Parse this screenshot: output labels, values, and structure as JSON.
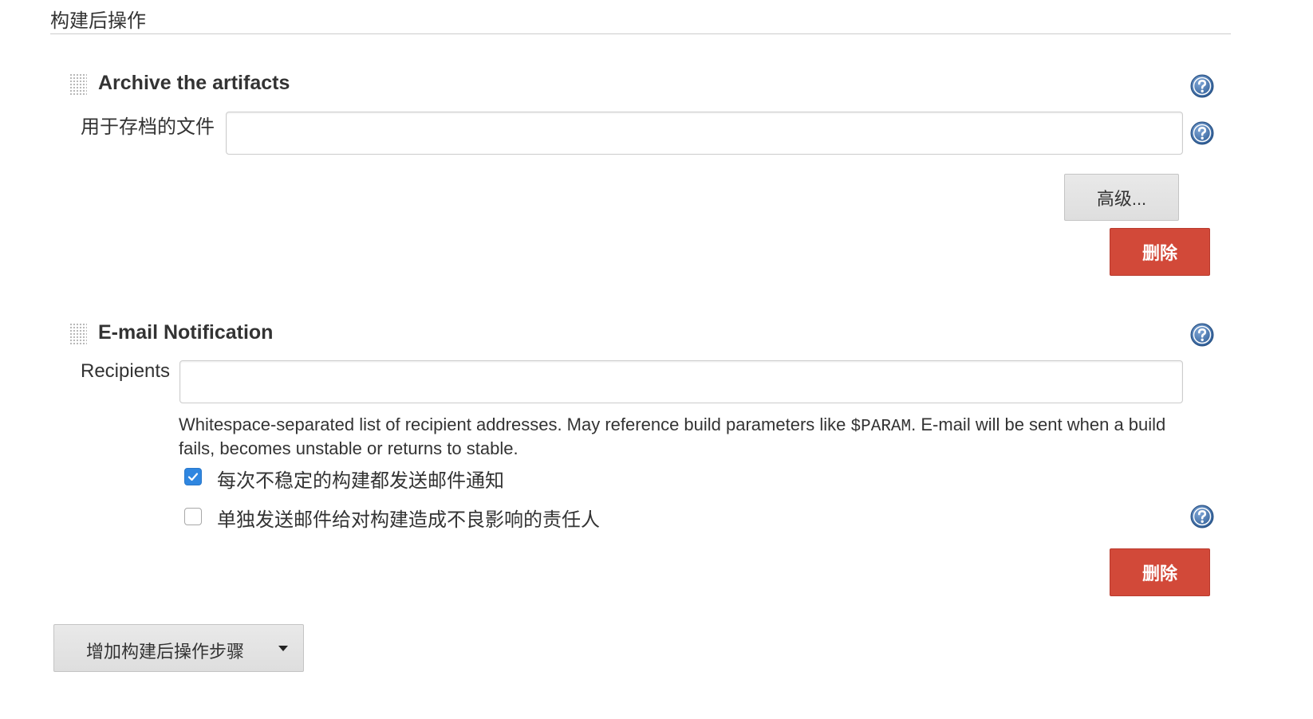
{
  "section": {
    "title": "构建后操作"
  },
  "archive": {
    "title": "Archive the artifacts",
    "files_label": "用于存档的文件",
    "files_value": "",
    "advanced_label": "高级...",
    "delete_label": "删除"
  },
  "email": {
    "title": "E-mail Notification",
    "recipients_label": "Recipients",
    "recipients_value": "",
    "description_before": "Whitespace-separated list of recipient addresses. May reference build parameters like ",
    "description_code": "$PARAM",
    "description_after": ". E-mail will be sent when a build fails, becomes unstable or returns to stable.",
    "option_unstable_label": "每次不稳定的构建都发送邮件通知",
    "option_unstable_checked": true,
    "option_individual_label": "单独发送邮件给对构建造成不良影响的责任人",
    "option_individual_checked": false,
    "delete_label": "删除"
  },
  "add_step": {
    "label": "增加构建后操作步骤"
  },
  "colors": {
    "danger": "#d24939",
    "checkbox_checked": "#2f86e0",
    "help_icon": "#3d6ea8"
  },
  "icons": [
    "drag-handle-icon",
    "help-icon",
    "checkmark-icon",
    "caret-down-icon"
  ]
}
